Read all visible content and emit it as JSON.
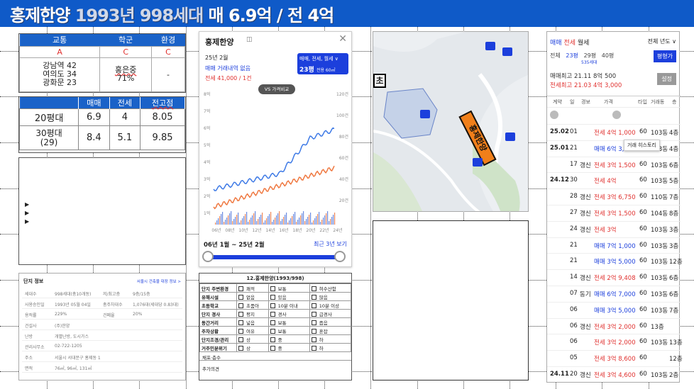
{
  "banner": {
    "title_main": "홍제한양 ",
    "title_ghost": "1993년 998세대",
    "title_tail": " 매 6.9억 / 전 4억"
  },
  "score": {
    "headers": [
      "교통",
      "학군",
      "환경"
    ],
    "grades": [
      "A",
      "C",
      "C"
    ],
    "transport": [
      "강남역 42",
      "여의도 34",
      "광화문 23"
    ],
    "school": [
      "홍은중",
      "71%"
    ],
    "env": "-"
  },
  "prices": {
    "headers": [
      "",
      "매매",
      "전세",
      "전고점"
    ],
    "rows": [
      [
        "20평대",
        "6.9",
        "4",
        "8.05"
      ],
      [
        "30평대\n(29)",
        "8.4",
        "5.1",
        "9.85"
      ]
    ]
  },
  "app": {
    "title": "홍제한양",
    "date": "25년 2월",
    "status": "매매 거래내역 없음",
    "lease": "전세 41,000 / 1건",
    "filter": "매매, 전세, 월세 ∨",
    "size": "23평",
    "size_sub": "전용 60㎡",
    "vs": "VS 가격비교",
    "y_left": [
      "8억",
      "7억",
      "6억",
      "5억",
      "4억",
      "3억",
      "2억",
      "1억"
    ],
    "y_right": [
      "120건",
      "100건",
      "80건",
      "60건",
      "40건",
      "20건"
    ],
    "x_labels": [
      "06년",
      "08년",
      "10년",
      "12년",
      "14년",
      "16년",
      "18년",
      "20년",
      "22년",
      "24년"
    ],
    "range": "06년 1월 ~ 25년 2월",
    "recent": "최근 3년 보기"
  },
  "map": {
    "school_label": "초",
    "highlight_label": "홍제한양"
  },
  "list": {
    "tabs": [
      "매매",
      "전세",
      "월세"
    ],
    "filter": "전체 년도 ∨",
    "size_tabs": [
      "전체",
      "23평",
      "29평",
      "40평"
    ],
    "size_sub": "535세대",
    "search_btn": "평형가",
    "setting_btn": "설정",
    "hi1": "매매최고 21.11 8억 500",
    "hi2": "전세최고 21.03 4억 3,000",
    "headers": [
      "계약",
      "일",
      "경보",
      "가격",
      "타입",
      "거래동",
      "층"
    ],
    "rows": [
      [
        "25.02",
        "01",
        "",
        "전세 4억 1,000",
        "60",
        "103동",
        "4층"
      ],
      [
        "25.01",
        "21",
        "",
        "매매 6억 3,500",
        "60",
        "103동",
        "4층"
      ],
      [
        "",
        "17",
        "갱신",
        "전세 3억 1,500",
        "60",
        "103동",
        "6층"
      ],
      [
        "24.12",
        "30",
        "",
        "전세 4억",
        "60",
        "103동",
        "5층"
      ],
      [
        "",
        "28",
        "갱신",
        "전세 3억 6,750",
        "60",
        "110동",
        "7층"
      ],
      [
        "",
        "27",
        "갱신",
        "전세 3억 1,500",
        "60",
        "104동",
        "8층"
      ],
      [
        "",
        "24",
        "갱신",
        "전세 3억",
        "60",
        "103동",
        "3층"
      ],
      [
        "",
        "21",
        "",
        "매매 7억 1,000",
        "60",
        "103동",
        "3층"
      ],
      [
        "",
        "21",
        "",
        "매매 3억 5,000",
        "60",
        "103동",
        "12층"
      ],
      [
        "",
        "14",
        "갱신",
        "전세 2억 9,408",
        "60",
        "103동",
        "6층"
      ],
      [
        "",
        "07",
        "동기",
        "매매 6억 7,000",
        "60",
        "103동",
        "6층"
      ],
      [
        "",
        "06",
        "",
        "매매 3억 5,000",
        "60",
        "103동",
        "7층"
      ],
      [
        "",
        "06",
        "갱신",
        "전세 3억 2,000",
        "60",
        "13층",
        ""
      ],
      [
        "",
        "06",
        "",
        "전세 3억 2,000",
        "60",
        "103동",
        "13층"
      ],
      [
        "",
        "05",
        "",
        "전세 3억 8,600",
        "60",
        "",
        "12층"
      ],
      [
        "24.11",
        "20",
        "갱신",
        "전세 3억 4,600",
        "60",
        "103동",
        "2층"
      ]
    ],
    "tooltip": "거래 히스토리"
  },
  "info": {
    "title": "단지 정보",
    "link": "서울시 건축물 대장 정보 >",
    "rows": [
      [
        "세대수",
        "998세대(총10개동)",
        "저/최고층",
        "9층/15층"
      ],
      [
        "사용승인일",
        "1993년 05월 04일",
        "총주차대수",
        "1,076대(세대당 0.83대)"
      ],
      [
        "용적률",
        "229%",
        "건폐율",
        "20%"
      ],
      [
        "건설사",
        "(주)한양",
        ""
      ],
      [
        "난방",
        "개별난방, 도시가스",
        ""
      ],
      [
        "관리사무소",
        "02-722-1205",
        ""
      ],
      [
        "주소",
        "서울시 서대문구 홍제동 1",
        "",
        ""
      ],
      [
        "면적",
        "76㎡, 96㎡, 131㎡",
        ""
      ]
    ]
  },
  "check": {
    "title": "12.홍제한양(1993/998)",
    "rows": [
      [
        "단지 주변환경",
        "쾌적",
        "보통",
        "혀수산함"
      ],
      [
        "유해시설",
        "없음",
        "있음",
        "많음"
      ],
      [
        "초등학교",
        "초품아",
        "10분 이내",
        "10분 이상"
      ],
      [
        "단지 경사",
        "평지",
        "경사",
        "급경사"
      ],
      [
        "동간거리",
        "넓음",
        "보통",
        "좁음"
      ],
      [
        "주차상황",
        "여유",
        "보통",
        "혼잡"
      ],
      [
        "단지조경/관리",
        "상",
        "중",
        "하"
      ],
      [
        "거주민분위기",
        "상",
        "중",
        "하"
      ]
    ],
    "wind": "채포·층수",
    "extra": "추가의견"
  }
}
